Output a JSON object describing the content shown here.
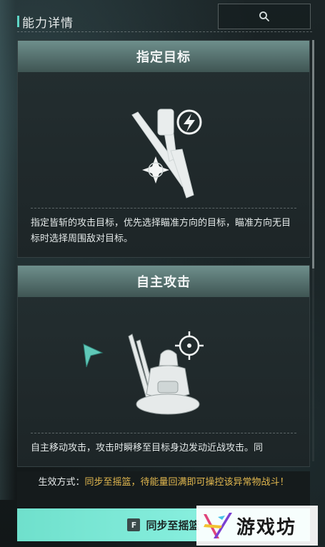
{
  "header": {
    "title": "能力详情",
    "search_icon": "search-icon"
  },
  "cards": [
    {
      "title": "指定目标",
      "icon": "katana-target-lightning-icon",
      "description": "指定皆斩的攻击目标，优先选择瞄准方向的目标，瞄准方向无目标时选择周围敌对目标。"
    },
    {
      "title": "自主攻击",
      "icon": "samurai-crosshair-icon",
      "description": "自主移动攻击，攻击时瞬移至目标身边发动近战攻击。同"
    }
  ],
  "effect": {
    "label": "生效方式：",
    "text": "同步至摇篮，待能量回满即可操控该异常物战斗！"
  },
  "action_button": {
    "key": "F",
    "label": "同步至摇篮"
  },
  "watermark": {
    "text": "游戏坊"
  },
  "colors": {
    "accent": "#6fe0cc",
    "gold": "#e2b84f",
    "card_header": "#5a7573"
  }
}
